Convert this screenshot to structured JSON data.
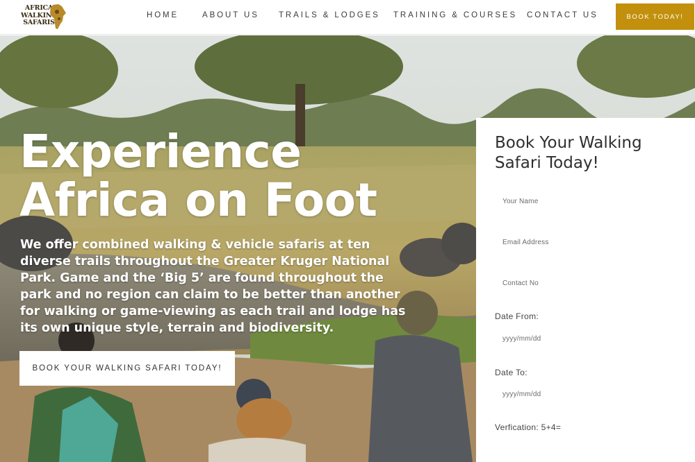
{
  "header": {
    "logo_text": [
      "AFRICA",
      "WALKING",
      "SAFARIS"
    ],
    "nav": [
      {
        "label": "HOME"
      },
      {
        "label": "ABOUT US"
      },
      {
        "label": "TRAILS & LODGES"
      },
      {
        "label": "TRAINING & COURSES"
      },
      {
        "label": "CONTACT US"
      }
    ],
    "book_button": "BOOK TODAY!"
  },
  "hero": {
    "title_line1": "Experience",
    "title_line2": "Africa on Foot",
    "description": "We offer combined walking & vehicle safaris at ten diverse trails throughout the Greater Kruger National Park. Game and the ‘Big 5’ are found throughout the park and no region can claim to be better than another for walking or game-viewing as each trail and lodge has its own unique style, terrain and biodiversity.",
    "cta": "BOOK YOUR WALKING SAFARI TODAY!"
  },
  "form": {
    "title": "Book Your Walking Safari Today!",
    "name_placeholder": "Your Name",
    "email_placeholder": "Email Address",
    "contact_placeholder": "Contact No",
    "date_from_label": "Date From:",
    "date_from_placeholder": "yyyy/mm/dd",
    "date_to_label": "Date To:",
    "date_to_placeholder": "yyyy/mm/dd",
    "verification_label": "Verfication: 5+4="
  },
  "colors": {
    "accent": "#c2900d",
    "nav_text": "#3b3b3b"
  }
}
